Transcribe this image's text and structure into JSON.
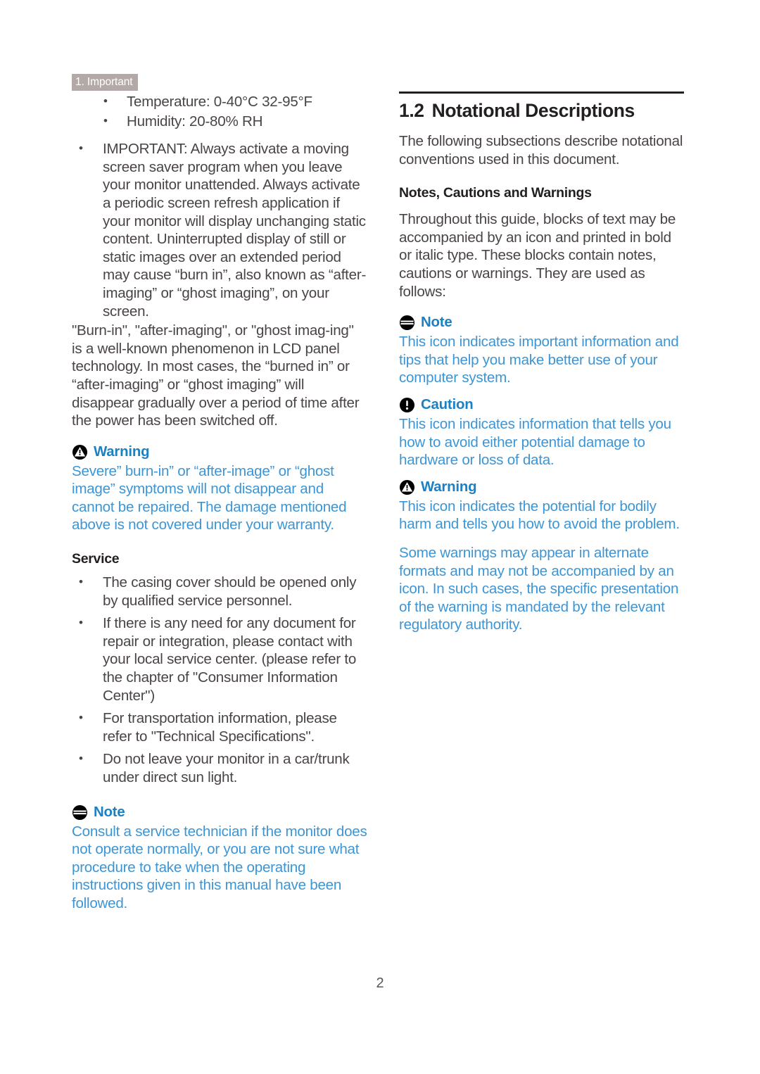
{
  "running_head": "1. Important",
  "page_number": "2",
  "colors": {
    "blue_title": "#1b80c4",
    "blue_body": "#3c95d4",
    "body_text": "#4a4446",
    "heading": "#231f20",
    "running_head_bg": "#b3a9a6"
  },
  "left_column": {
    "spec_bullets": [
      "Temperature: 0-40°C 32-95°F",
      "Humidity: 20-80% RH"
    ],
    "important_bullet": "IMPORTANT: Always activate a moving screen saver program when you leave your monitor unattended. Always activate a periodic screen refresh application if your monitor will display unchanging static content. Uninterrupted display of still or static images over an extended period may cause “burn in”, also known as “after-imaging” or “ghost imaging”, on your screen.",
    "burn_in_paragraph": "\"Burn-in\", \"after-imaging\", or \"ghost imag-ing\" is a well-known phenomenon in LCD panel technology. In most cases, the “burned in” or “after-imaging” or “ghost imaging” will disappear gradually over a period of time after the power has been switched off.",
    "warning": {
      "icon": "warning-triangle-icon",
      "title": "Warning",
      "body": "Severe” burn-in” or “after-image” or “ghost image” symptoms will not disappear and cannot be repaired. The damage mentioned above is not covered under your warranty."
    },
    "service_heading": "Service",
    "service_bullets": [
      "The casing cover should be opened only by qualified service personnel.",
      "If there is any need for any document for repair or integration, please contact with your local service center. (please refer to the chapter of \"Consumer Information Center\")",
      "For transportation information, please refer to \"Technical Specifications\".",
      "Do not leave your monitor in a car/trunk under direct sun light."
    ],
    "note": {
      "icon": "note-lines-icon",
      "title": "Note",
      "body": "Consult a service technician if the monitor does not operate normally, or you are not sure what procedure to take when the operating instructions given in this manual have been followed."
    }
  },
  "right_column": {
    "section_number": "1.2",
    "section_title": "Notational Descriptions",
    "intro": "The following subsections describe notational conventions used in this document.",
    "subheading": "Notes, Cautions and Warnings",
    "intro2": "Throughout this guide, blocks of text may be accompanied by an icon and printed in bold or italic type. These blocks contain notes, cautions or warnings. They are used as follows:",
    "note": {
      "icon": "note-lines-icon",
      "title": "Note",
      "body": "This icon indicates important information and tips that help you make better use of your computer system."
    },
    "caution": {
      "icon": "caution-exclamation-icon",
      "title": "Caution",
      "body": "This icon indicates information that tells you how to avoid either potential damage to hardware or loss of data."
    },
    "warning": {
      "icon": "warning-triangle-icon",
      "title": "Warning",
      "body": "This icon indicates the potential for bodily harm and tells you how to avoid the problem.",
      "body2": "Some warnings may appear in alternate formats and may not be accompanied by an icon. In such cases, the specific presentation of the warning is mandated by the relevant regulatory authority."
    }
  }
}
